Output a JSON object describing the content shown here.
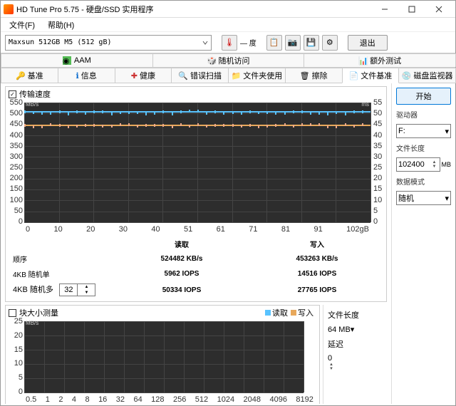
{
  "window": {
    "title": "HD Tune Pro 5.75 - 硬盘/SSD 实用程序"
  },
  "menubar": {
    "file": "文件(F)",
    "help": "帮助(H)"
  },
  "toolbar": {
    "drive": "Maxsun  512GB M5 (512 gB)",
    "exit": "退出"
  },
  "tabs1": {
    "aam": "AAM",
    "random": "随机访问",
    "extra": "额外测试"
  },
  "tabs2": {
    "benchmark": "基准",
    "info": "信息",
    "health": "健康",
    "errorscan": "错误扫描",
    "folder": "文件夹使用",
    "erase": "擦除",
    "filebench": "文件基准",
    "diskmon": "磁盘监视器"
  },
  "side": {
    "start": "开始",
    "driver_lbl": "驱动器",
    "driver_val": "F:",
    "filelen_lbl": "文件长度",
    "filelen_val": "102400",
    "filelen_unit": "MB",
    "pattern_lbl": "数据模式",
    "pattern_val": "随机"
  },
  "transfer": {
    "title": "传输速度",
    "yunit": "MB/s",
    "yunit2": "ms",
    "yticks": [
      "550",
      "500",
      "450",
      "400",
      "350",
      "300",
      "250",
      "200",
      "150",
      "100",
      "50",
      "0"
    ],
    "yticks2": [
      "55",
      "50",
      "45",
      "40",
      "35",
      "30",
      "25",
      "20",
      "15",
      "10",
      "5",
      "0"
    ],
    "xticks": [
      "0",
      "10",
      "20",
      "30",
      "40",
      "51",
      "61",
      "71",
      "81",
      "91",
      "102gB"
    ],
    "headers": {
      "read": "读取",
      "write": "写入"
    },
    "rows": {
      "seq": {
        "label": "顺序",
        "read": "524482 KB/s",
        "write": "453263 KB/s"
      },
      "rnd1": {
        "label": "4KB 随机单",
        "read": "5962 IOPS",
        "write": "14516 IOPS"
      },
      "rnd_multi": {
        "label": "4KB 随机多",
        "spin": "32",
        "read": "50334 IOPS",
        "write": "27765 IOPS"
      }
    }
  },
  "blocksize": {
    "title": "块大小测量",
    "legend_read": "读取",
    "legend_write": "写入",
    "yunit": "MB/s",
    "yticks": [
      "25",
      "20",
      "15",
      "10",
      "5",
      "0"
    ],
    "xticks": [
      "0.5",
      "1",
      "2",
      "4",
      "8",
      "16",
      "32",
      "64",
      "128",
      "256",
      "512",
      "1024",
      "2048",
      "4096",
      "8192"
    ]
  },
  "side2": {
    "filelen_lbl": "文件长度",
    "filelen_val": "64 MB",
    "delay_lbl": "延迟",
    "delay_val": "0"
  },
  "chart_data": {
    "type": "line",
    "title": "传输速度",
    "xlabel": "gB",
    "ylabel": "MB/s",
    "ylim": [
      0,
      550
    ],
    "x": [
      0,
      10,
      20,
      30,
      40,
      51,
      61,
      71,
      81,
      91,
      102
    ],
    "series": [
      {
        "name": "读取",
        "values": [
          510,
          510,
          510,
          510,
          510,
          512,
          510,
          510,
          510,
          510,
          510
        ],
        "color": "#59c3ff"
      },
      {
        "name": "写入",
        "values": [
          450,
          450,
          450,
          450,
          448,
          450,
          450,
          448,
          450,
          450,
          450
        ],
        "color": "#e8a85b"
      }
    ]
  }
}
